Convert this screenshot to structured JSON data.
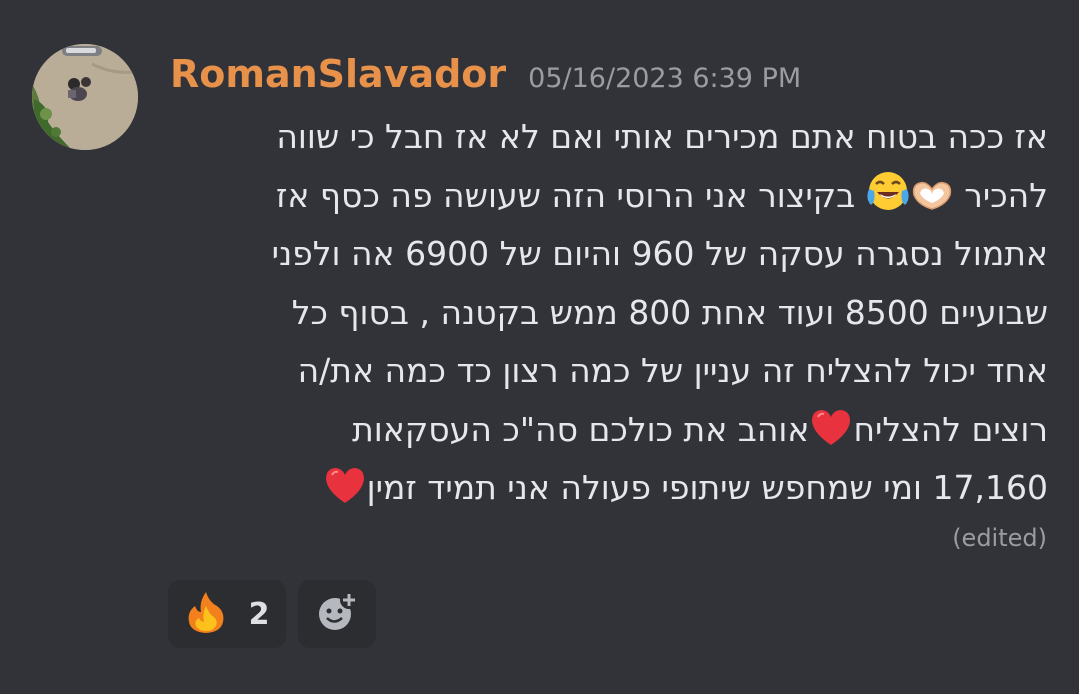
{
  "author": {
    "username": "RomanSlavador",
    "timestamp": "05/16/2023 6:39 PM",
    "avatar_icon": "avatar-photo"
  },
  "message": {
    "lines": [
      "אז ככה בטוח אתם מכירים אותי ואם לא אז חבל כי שווה",
      "להכיר",
      "בקיצור אני הרוסי הזה שעושה פה כסף אז",
      "אתמול נסגרה עסקה של 960 והיום של 6900 אה ולפני",
      "שבועיים 8500 ועוד אחת 800 ממש בקטנה , בסוף כל",
      "אחד יכול להצליח זה עניין של כמה רצון כד כמה את/ה",
      "רוצים להצליח",
      "אוהב את כולכם   סה\"כ העסקאות",
      "17,160 ומי שמחפש שיתופי פעולה אני תמיד זמין"
    ],
    "emojis": {
      "heart_hands": "heart-hands-icon",
      "tears_of_joy": "face-with-tears-of-joy-icon",
      "red_heart": "red-heart-icon"
    },
    "edited_label": "(edited)"
  },
  "reactions": [
    {
      "emoji": "fire-icon",
      "count": "2"
    }
  ],
  "add_reaction_icon": "add-reaction-icon",
  "colors": {
    "background": "#313338",
    "username": "#e8914a",
    "timestamp": "#9a9ca3",
    "text": "#e6e7ea",
    "reaction_bg": "#2b2d31"
  }
}
